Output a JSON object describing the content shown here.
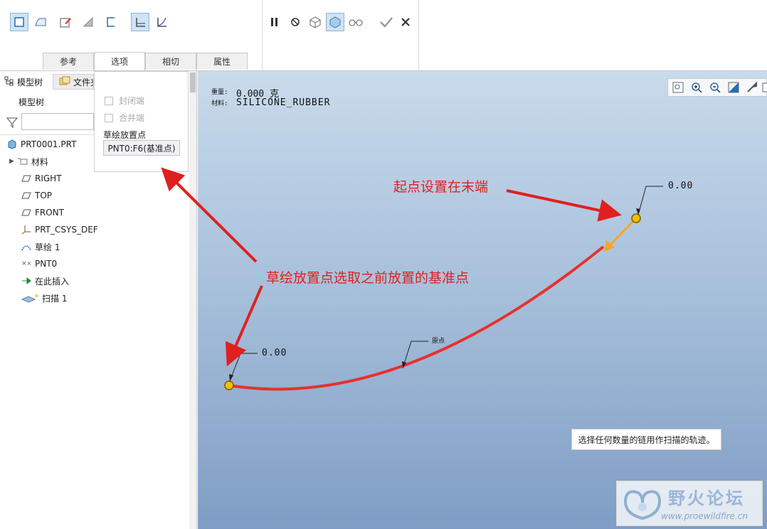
{
  "ribbon": {
    "tabs": [
      {
        "label": "参考"
      },
      {
        "label": "选项"
      },
      {
        "label": "相切"
      },
      {
        "label": "属性"
      }
    ],
    "tools_left": [
      "solid-icon",
      "surface-icon",
      "sketch-edit-icon",
      "remove-material-icon",
      "thicken-icon",
      "constant-section-icon",
      "variable-section-icon"
    ],
    "tools_right": [
      "pause-icon",
      "no-preview-icon",
      "geometry-preview-icon",
      "verify-icon",
      "glasses-icon",
      "confirm-icon",
      "cancel-icon"
    ]
  },
  "options": {
    "seal_ends": "封闭端",
    "merge_ends": "合并端",
    "sketch_placement_label": "草绘放置点",
    "sketch_placement_value": "PNT0:F6(基准点)"
  },
  "panel": {
    "tab_model_tree": "模型树",
    "tab_folder": "文件夹",
    "title": "模型树",
    "filter_placeholder": ""
  },
  "tree": {
    "items": [
      {
        "label": "PRT0001.PRT"
      },
      {
        "label": "材料"
      },
      {
        "label": "RIGHT"
      },
      {
        "label": "TOP"
      },
      {
        "label": "FRONT"
      },
      {
        "label": "PRT_CSYS_DEF"
      },
      {
        "label": "草绘 1"
      },
      {
        "label": "PNT0"
      },
      {
        "label": "在此插入"
      },
      {
        "label": "扫描 1"
      }
    ]
  },
  "viewport": {
    "mass_label": "重量:",
    "mass_value": "0.000 克",
    "material_label": "材料:",
    "material_value": "SILICONE_RUBBER",
    "dim_top": "0.00",
    "dim_bottom": "0.00",
    "origin_label": "原点",
    "message": "选择任何数量的链用作扫描的轨迹。"
  },
  "annotations": {
    "start_point": "起点设置在末端",
    "sketch_point": "草绘放置点选取之前放置的基准点"
  },
  "watermark": {
    "title": "野火论坛",
    "url": "www.proewildfire.cn"
  },
  "colors": {
    "trajectory": "#e8302d",
    "annotation": "#e0201f",
    "point": "#f5c000",
    "arrow_orange": "#f5a623"
  }
}
